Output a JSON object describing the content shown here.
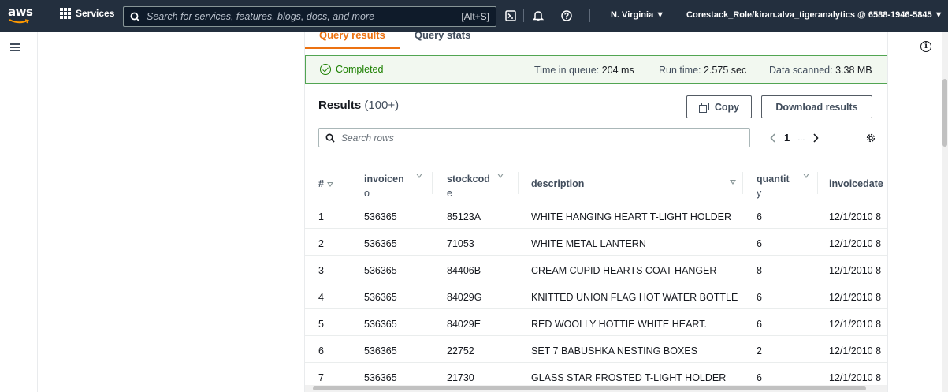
{
  "nav": {
    "logo": "aws",
    "services_label": "Services",
    "search_placeholder": "Search for services, features, blogs, docs, and more",
    "search_shortcut": "[Alt+S]",
    "region": "N. Virginia ▼",
    "account": "Corestack_Role/kiran.alva_tigeranalytics @ 6588-1946-5845 ▼"
  },
  "tabs": [
    {
      "label": "Query results",
      "active": true
    },
    {
      "label": "Query stats",
      "active": false
    }
  ],
  "status": {
    "state": "Completed",
    "time_in_queue_label": "Time in queue:",
    "time_in_queue": "204 ms",
    "run_time_label": "Run time:",
    "run_time": "2.575 sec",
    "data_scanned_label": "Data scanned:",
    "data_scanned": "3.38 MB"
  },
  "results": {
    "title": "Results",
    "count": "(100+)",
    "copy_label": "Copy",
    "download_label": "Download results",
    "search_placeholder": "Search rows",
    "page": "1",
    "ellipsis": "..."
  },
  "columns": [
    {
      "line1": "#",
      "line2": ""
    },
    {
      "line1": "invoicen",
      "line2": "o"
    },
    {
      "line1": "stockcod",
      "line2": "e"
    },
    {
      "line1": "description",
      "line2": ""
    },
    {
      "line1": "quantit",
      "line2": "y"
    },
    {
      "line1": "invoicedate",
      "line2": ""
    }
  ],
  "rows": [
    [
      "1",
      "536365",
      "85123A",
      "WHITE HANGING HEART T-LIGHT HOLDER",
      "6",
      "12/1/2010 8"
    ],
    [
      "2",
      "536365",
      "71053",
      "WHITE METAL LANTERN",
      "6",
      "12/1/2010 8"
    ],
    [
      "3",
      "536365",
      "84406B",
      "CREAM CUPID HEARTS COAT HANGER",
      "8",
      "12/1/2010 8"
    ],
    [
      "4",
      "536365",
      "84029G",
      "KNITTED UNION FLAG HOT WATER BOTTLE",
      "6",
      "12/1/2010 8"
    ],
    [
      "5",
      "536365",
      "84029E",
      "RED WOOLLY HOTTIE WHITE HEART.",
      "6",
      "12/1/2010 8"
    ],
    [
      "6",
      "536365",
      "22752",
      "SET 7 BABUSHKA NESTING BOXES",
      "2",
      "12/1/2010 8"
    ],
    [
      "7",
      "536365",
      "21730",
      "GLASS STAR FROSTED T-LIGHT HOLDER",
      "6",
      "12/1/2010 8"
    ]
  ],
  "colors": {
    "nav_bg": "#232f3e",
    "accent_orange": "#ec7211",
    "success_green": "#1d8102",
    "success_bg": "#f2f8f0"
  },
  "icons": [
    "aws-logo",
    "grid-icon",
    "search-icon",
    "cloudshell-icon",
    "bell-icon",
    "help-icon",
    "menu-icon",
    "info-icon",
    "check-circle-icon",
    "copy-icon",
    "chevron-left-icon",
    "chevron-right-icon",
    "gear-icon",
    "sort-icon"
  ]
}
